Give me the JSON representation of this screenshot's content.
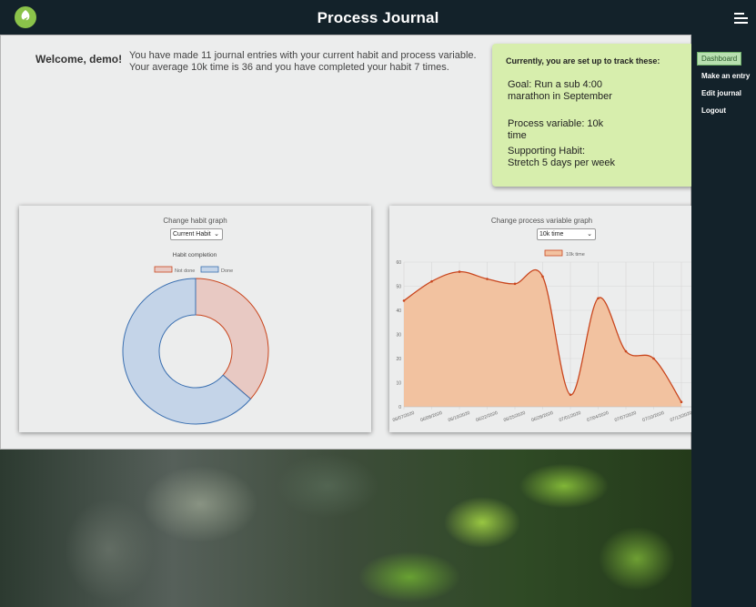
{
  "header": {
    "title": "Process Journal",
    "logo_icon": "tree-icon",
    "menu_icon": "hamburger-icon"
  },
  "sidebar": {
    "items": [
      {
        "label": "Dashboard",
        "active": true
      },
      {
        "label": "Make an entry",
        "active": false
      },
      {
        "label": "Edit journal",
        "active": false
      },
      {
        "label": "Logout",
        "active": false
      }
    ]
  },
  "welcome": {
    "greeting": "Welcome, demo!",
    "line1": "You have made 11 journal entries with your current habit and process variable.",
    "line2": "Your average 10k time is 36 and you have completed your habit 7 times."
  },
  "tracking": {
    "title": "Currently, you are set up to track these:",
    "goal": "Goal: Run a sub 4:00 marathon in September",
    "process_variable": "Process variable: 10k time",
    "habit": "Supporting Habit: Stretch 5 days per week"
  },
  "habit_card": {
    "title": "Change habit graph",
    "select_value": "Current Habit",
    "chart_data": {
      "type": "pie",
      "title": "Habit completion",
      "labels": [
        "Not done",
        "Done"
      ],
      "values": [
        4,
        7
      ],
      "colors": [
        "#e8c9c3",
        "#c4d4e8"
      ],
      "borders": [
        "#c9461e",
        "#3a6fb0"
      ],
      "legend": "top"
    }
  },
  "process_card": {
    "title": "Change process variable graph",
    "select_value": "10k time",
    "chart_data": {
      "type": "area",
      "series": [
        {
          "name": "10k time",
          "color": "#c9461e",
          "fill": "#f2c2a0"
        }
      ],
      "x": [
        "06/07/2020",
        "06/08/2020",
        "06/19/2020",
        "06/22/2020",
        "06/25/2020",
        "06/28/2020",
        "07/01/2020",
        "07/04/2020",
        "07/07/2020",
        "07/10/2020",
        "07/13/2020"
      ],
      "values": [
        44,
        52,
        56,
        53,
        51,
        54,
        5,
        45,
        23,
        20,
        2
      ],
      "ylim": [
        0,
        60
      ],
      "yticks": [
        0,
        10,
        20,
        30,
        40,
        50,
        60
      ],
      "grid": true,
      "legend": "top"
    }
  }
}
